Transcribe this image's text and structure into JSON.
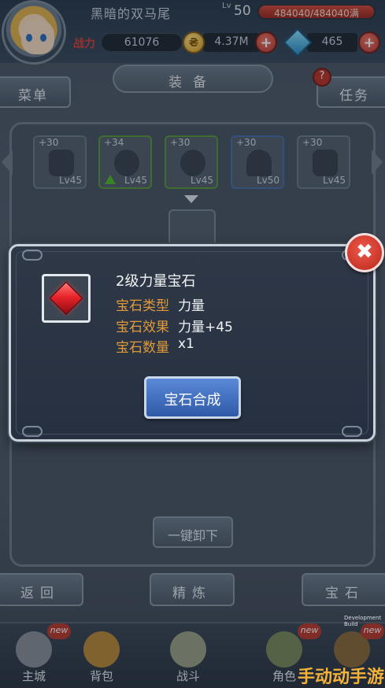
{
  "player": {
    "name": "黑暗的双马尾",
    "lv_label": "Lv",
    "level": "50",
    "exp_text": "484040/484040满",
    "power_label": "战力",
    "power": "61076",
    "coin_symbol": "₴",
    "coins": "4.37M",
    "gems": "465"
  },
  "nav": {
    "menu": "菜单",
    "title": "装备",
    "tasks": "任务",
    "task_badge": "?"
  },
  "equipment": [
    {
      "plus": "+30",
      "lv": "Lv45"
    },
    {
      "plus": "+34",
      "lv": "Lv45"
    },
    {
      "plus": "+30",
      "lv": "Lv45"
    },
    {
      "plus": "+30",
      "lv": "Lv50"
    },
    {
      "plus": "+30",
      "lv": "Lv45"
    }
  ],
  "buttons": {
    "unequip_all": "一键卸下",
    "back": "返回",
    "refine": "精炼",
    "gem": "宝石"
  },
  "bottom_nav": [
    {
      "label": "主城",
      "badge": "new"
    },
    {
      "label": "背包",
      "badge": ""
    },
    {
      "label": "战斗",
      "badge": ""
    },
    {
      "label": "角色",
      "badge": "new"
    },
    {
      "label": "",
      "badge": "new"
    }
  ],
  "dialog": {
    "close_symbol": "✖",
    "gem_name": "2级力量宝石",
    "type_label": "宝石类型",
    "type_value": "力量",
    "effect_label": "宝石效果",
    "effect_value": "力量+45",
    "count_label": "宝石数量",
    "count_value": "x1",
    "synthesize": "宝石合成"
  },
  "watermark": {
    "text": "手动动手游",
    "small": "Development Build"
  },
  "exp_fraction": 1.0,
  "colors": {
    "accent_red": "#d8413a",
    "attr_label": "#e09a3a",
    "synth_button": "#3d6cc0"
  },
  "icons": {
    "coin": "coin-icon",
    "gem": "blue-gem-icon",
    "item": "red-gem-icon",
    "close": "close-icon"
  }
}
